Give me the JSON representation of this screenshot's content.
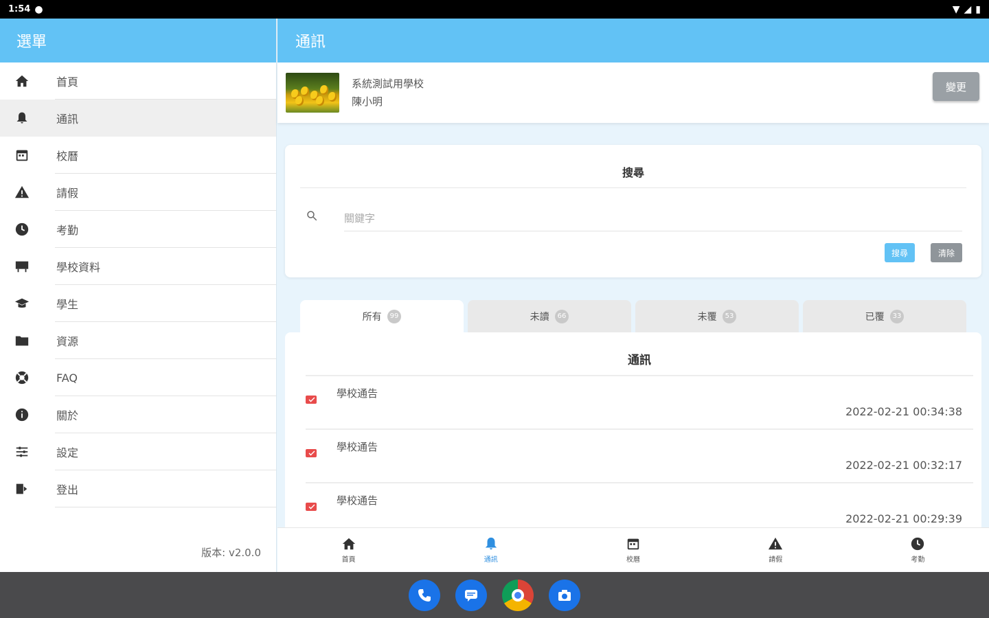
{
  "status_bar": {
    "time": "1:54",
    "notification_icon": "chat-bubble-icon",
    "right_icons": [
      "wifi-icon",
      "signal-icon",
      "battery-icon"
    ]
  },
  "sidebar": {
    "title": "選單",
    "items": [
      {
        "label": "首頁",
        "icon": "home-icon"
      },
      {
        "label": "通訊",
        "icon": "bell-icon",
        "active": true
      },
      {
        "label": "校曆",
        "icon": "calendar-icon"
      },
      {
        "label": "請假",
        "icon": "warning-icon"
      },
      {
        "label": "考勤",
        "icon": "clock-icon"
      },
      {
        "label": "學校資料",
        "icon": "board-icon"
      },
      {
        "label": "學生",
        "icon": "graduation-cap-icon"
      },
      {
        "label": "資源",
        "icon": "folder-icon"
      },
      {
        "label": "FAQ",
        "icon": "lifebuoy-icon"
      },
      {
        "label": "關於",
        "icon": "info-icon"
      },
      {
        "label": "設定",
        "icon": "sliders-icon"
      },
      {
        "label": "登出",
        "icon": "logout-icon"
      }
    ],
    "version": "版本: v2.0.0"
  },
  "header": {
    "title": "通訊"
  },
  "profile": {
    "school": "系統測試用學校",
    "name": "陳小明",
    "switch_label": "變更"
  },
  "search": {
    "title": "搜尋",
    "placeholder": "關鍵字",
    "search_label": "搜尋",
    "clear_label": "清除"
  },
  "tabs": [
    {
      "label": "所有",
      "count": "99",
      "active": true
    },
    {
      "label": "未讀",
      "count": "66"
    },
    {
      "label": "未覆",
      "count": "53"
    },
    {
      "label": "已覆",
      "count": "33"
    }
  ],
  "list": {
    "title": "通訊",
    "items": [
      {
        "title": "學校通告",
        "time": "2022-02-21 00:34:38"
      },
      {
        "title": "學校通告",
        "time": "2022-02-21 00:32:17"
      },
      {
        "title": "學校通告",
        "time": "2022-02-21 00:29:39"
      }
    ]
  },
  "bottom_nav": [
    {
      "label": "首頁",
      "icon": "home-icon"
    },
    {
      "label": "通訊",
      "icon": "bell-icon",
      "active": true
    },
    {
      "label": "校曆",
      "icon": "calendar-icon"
    },
    {
      "label": "請假",
      "icon": "warning-icon"
    },
    {
      "label": "考勤",
      "icon": "clock-icon"
    }
  ],
  "dock": [
    "phone-app-icon",
    "messages-app-icon",
    "chrome-app-icon",
    "camera-app-icon"
  ],
  "colors": {
    "primary": "#62c2f5",
    "active_nav": "#2f8fe0",
    "mail_red": "#e84b4b"
  }
}
